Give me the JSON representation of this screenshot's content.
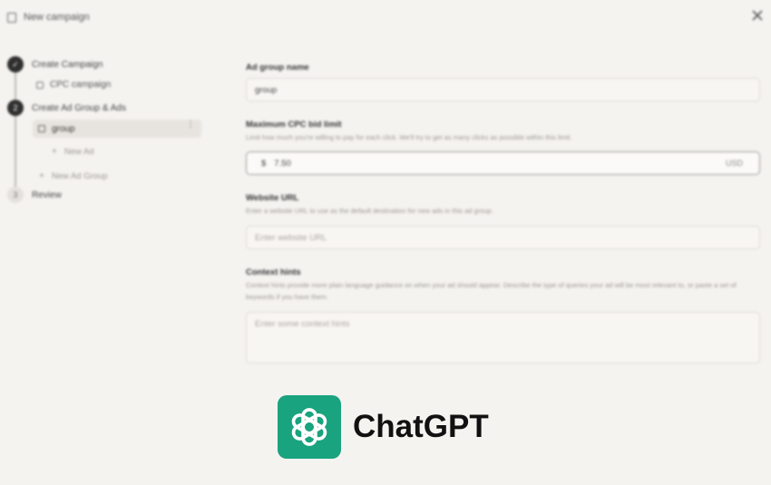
{
  "header": {
    "title": "New campaign",
    "doc_icon": "document-icon",
    "close_icon": "close-icon"
  },
  "sidebar": {
    "steps": [
      {
        "number": "✓",
        "label": "Create Campaign",
        "state": "done"
      },
      {
        "number": "2",
        "label": "Create Ad Group & Ads",
        "state": "active"
      },
      {
        "number": "3",
        "label": "Review",
        "state": "pending"
      }
    ],
    "campaign_item": "CPC campaign",
    "group_item": "group",
    "new_ad": "New Ad",
    "new_ad_group": "New Ad Group"
  },
  "form": {
    "ad_group_name": {
      "label": "Ad group name",
      "value": "group"
    },
    "max_cpc": {
      "label": "Maximum CPC bid limit",
      "help": "Limit how much you're willing to pay for each click. We'll try to get as many clicks as possible within this limit.",
      "currency": "$",
      "value": "7.50",
      "unit": "USD"
    },
    "website_url": {
      "label": "Website URL",
      "help": "Enter a website URL to use as the default destination for new ads in this ad group.",
      "placeholder": "Enter website URL"
    },
    "context_hints": {
      "label": "Context hints",
      "help": "Context hints provide more plain language guidance on when your ad should appear. Describe the type of queries your ad will be most relevant to, or paste a set of keywords if you have them.",
      "placeholder": "Enter some context hints"
    }
  },
  "brand": {
    "name": "ChatGPT",
    "color": "#19a37f",
    "icon": "openai-logo-icon"
  }
}
